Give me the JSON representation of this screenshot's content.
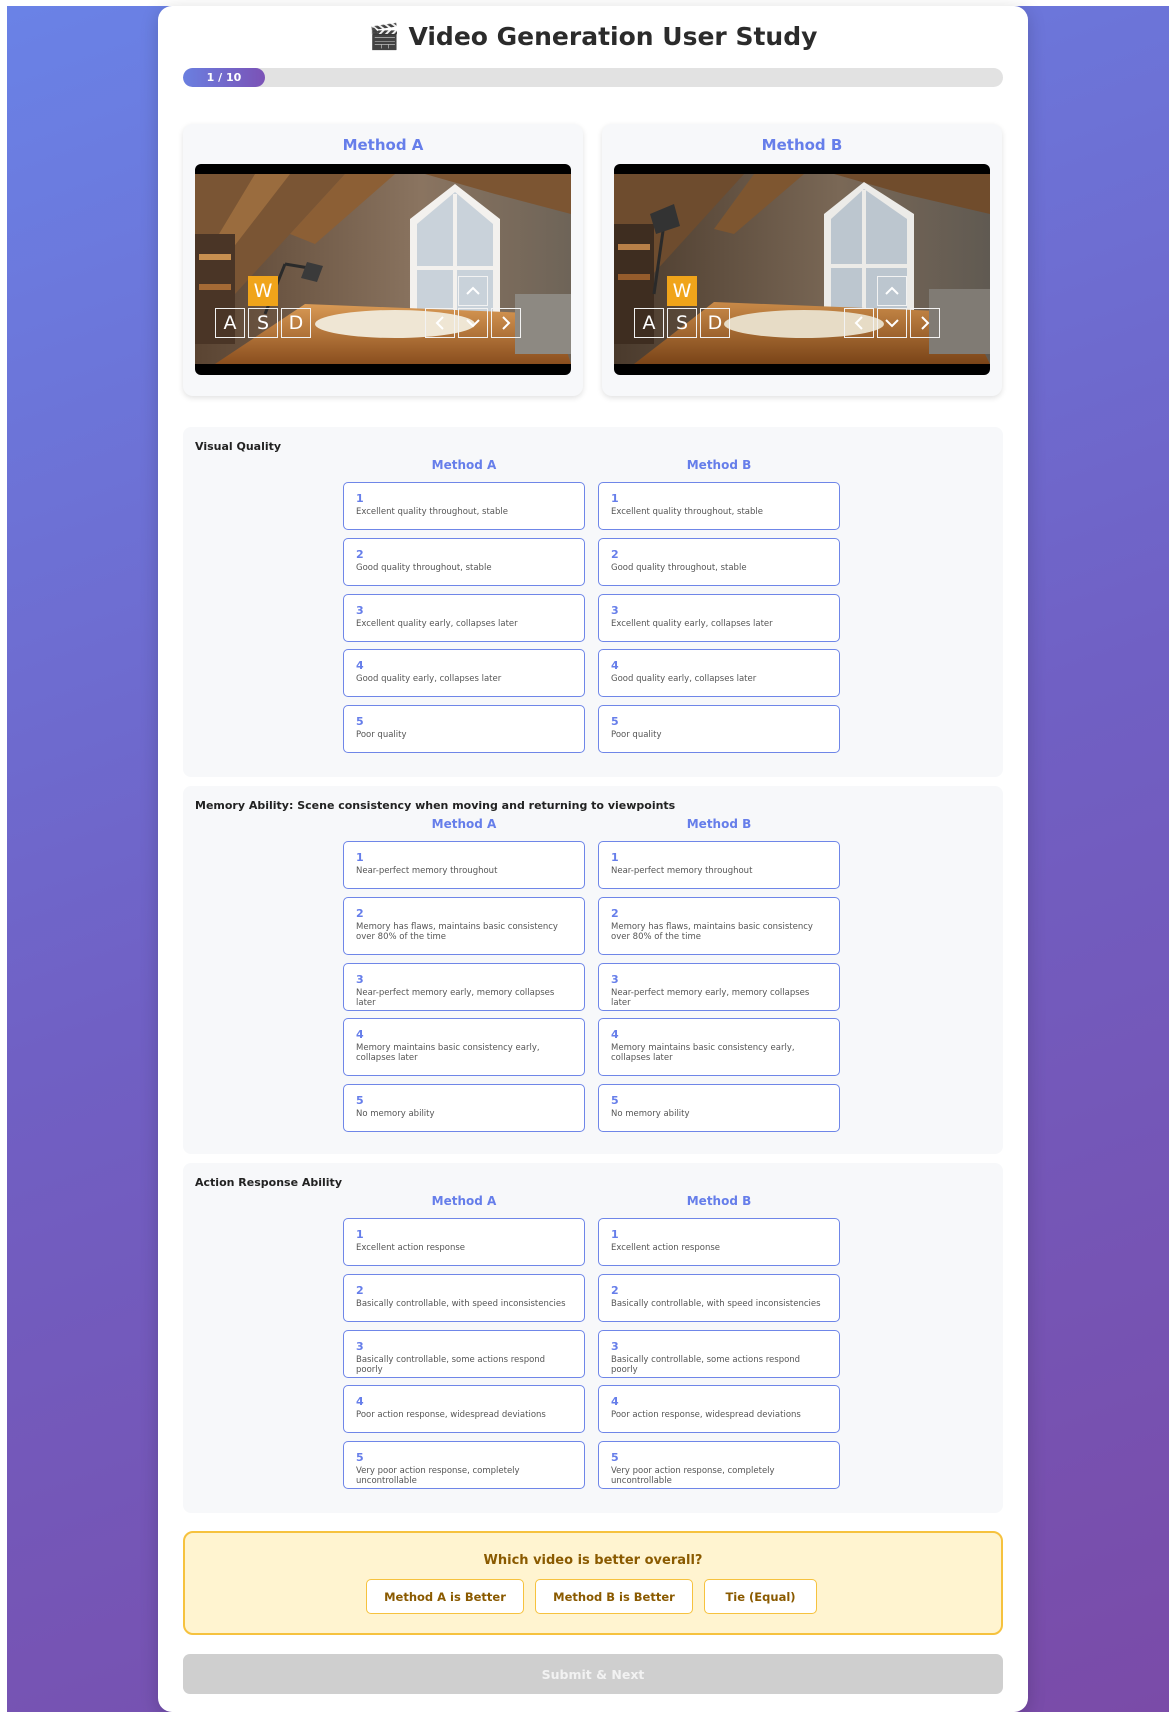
{
  "header": {
    "title": "🎬 Video Generation User Study"
  },
  "progress": {
    "label": "1 / 10",
    "current": 1,
    "total": 10,
    "fraction": 0.1
  },
  "videos": [
    {
      "label": "Method A",
      "keys": [
        "W",
        "A",
        "S",
        "D"
      ],
      "active_key": "W"
    },
    {
      "label": "Method B",
      "keys": [
        "W",
        "A",
        "S",
        "D"
      ],
      "active_key": "W"
    }
  ],
  "sections": [
    {
      "title": "Visual Quality",
      "col_a": "Method A",
      "col_b": "Method B",
      "options": [
        {
          "num": "1",
          "desc": "Excellent quality throughout, stable"
        },
        {
          "num": "2",
          "desc": "Good quality throughout, stable"
        },
        {
          "num": "3",
          "desc": "Excellent quality early, collapses later"
        },
        {
          "num": "4",
          "desc": "Good quality early, collapses later"
        },
        {
          "num": "5",
          "desc": "Poor quality"
        }
      ]
    },
    {
      "title": "Memory Ability: Scene consistency when moving and returning to viewpoints",
      "col_a": "Method A",
      "col_b": "Method B",
      "options": [
        {
          "num": "1",
          "desc": "Near-perfect memory throughout"
        },
        {
          "num": "2",
          "desc": "Memory has flaws, maintains basic consistency over 80% of the time"
        },
        {
          "num": "3",
          "desc": "Near-perfect memory early, memory collapses later"
        },
        {
          "num": "4",
          "desc": "Memory maintains basic consistency early, collapses later"
        },
        {
          "num": "5",
          "desc": "No memory ability"
        }
      ]
    },
    {
      "title": "Action Response Ability",
      "col_a": "Method A",
      "col_b": "Method B",
      "options": [
        {
          "num": "1",
          "desc": "Excellent action response"
        },
        {
          "num": "2",
          "desc": "Basically controllable, with speed inconsistencies"
        },
        {
          "num": "3",
          "desc": "Basically controllable, some actions respond poorly"
        },
        {
          "num": "4",
          "desc": "Poor action response, widespread deviations"
        },
        {
          "num": "5",
          "desc": "Very poor action response, completely uncontrollable"
        }
      ]
    }
  ],
  "overall": {
    "question": "Which video is better overall?",
    "choices": [
      "Method A is Better",
      "Method B is Better",
      "Tie (Equal)"
    ]
  },
  "submit": {
    "label": "Submit & Next"
  },
  "colors": {
    "accent": "#667eea",
    "gold": "#f6c23e",
    "key_active": "#f0a41a"
  }
}
